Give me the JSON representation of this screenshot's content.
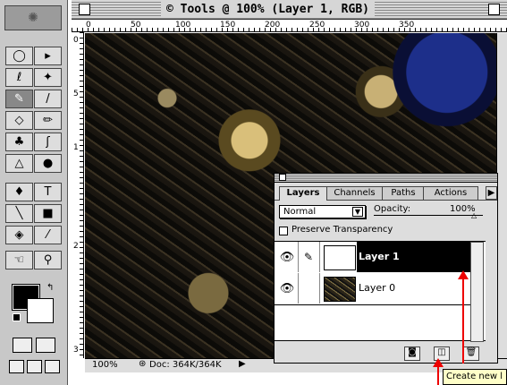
{
  "window": {
    "title": "© Tools @ 100% (Layer 1, RGB)"
  },
  "rulers": {
    "horizontal": [
      "0",
      "50",
      "100",
      "150",
      "200",
      "250",
      "300",
      "350"
    ],
    "vertical": [
      "0",
      "5",
      "1",
      "2",
      "3"
    ]
  },
  "toolbox": {
    "tools": [
      {
        "name": "marquee-tool",
        "glyph": "◯"
      },
      {
        "name": "move-tool",
        "glyph": "▸"
      },
      {
        "name": "lasso-tool",
        "glyph": "ℓ"
      },
      {
        "name": "magic-wand-tool",
        "glyph": "✦"
      },
      {
        "name": "airbrush-tool",
        "glyph": "✎"
      },
      {
        "name": "paintbrush-tool",
        "glyph": "/"
      },
      {
        "name": "eraser-tool",
        "glyph": "◇"
      },
      {
        "name": "pencil-tool",
        "glyph": "✏"
      },
      {
        "name": "rubber-stamp-tool",
        "glyph": "♣"
      },
      {
        "name": "smudge-tool",
        "glyph": "ʃ"
      },
      {
        "name": "blur-tool",
        "glyph": "△"
      },
      {
        "name": "dodge-tool",
        "glyph": "●"
      },
      {
        "name": "pen-tool",
        "glyph": "♦"
      },
      {
        "name": "type-tool",
        "glyph": "T"
      },
      {
        "name": "line-tool",
        "glyph": "╲"
      },
      {
        "name": "gradient-tool",
        "glyph": "■"
      },
      {
        "name": "paint-bucket-tool",
        "glyph": "◈"
      },
      {
        "name": "eyedropper-tool",
        "glyph": "⁄"
      },
      {
        "name": "hand-tool",
        "glyph": "☜"
      },
      {
        "name": "zoom-tool",
        "glyph": "⚲"
      }
    ]
  },
  "layers_palette": {
    "tabs": [
      "Layers",
      "Channels",
      "Paths",
      "Actions"
    ],
    "active_tab": "Layers",
    "blend_mode": "Normal",
    "opacity_label": "Opacity:",
    "opacity_value": "100%",
    "preserve_transparency": "Preserve Transparency",
    "layers": [
      {
        "name": "Layer 1",
        "selected": true
      },
      {
        "name": "Layer 0",
        "selected": false
      }
    ]
  },
  "status_bar": {
    "zoom": "100%",
    "doc": "Doc: 364K/364K"
  },
  "tooltip": {
    "text": "Create new l"
  },
  "colors": {
    "selection": "#000000",
    "annotation_arrow": "#e00000",
    "tooltip_bg": "#ffffc8"
  }
}
